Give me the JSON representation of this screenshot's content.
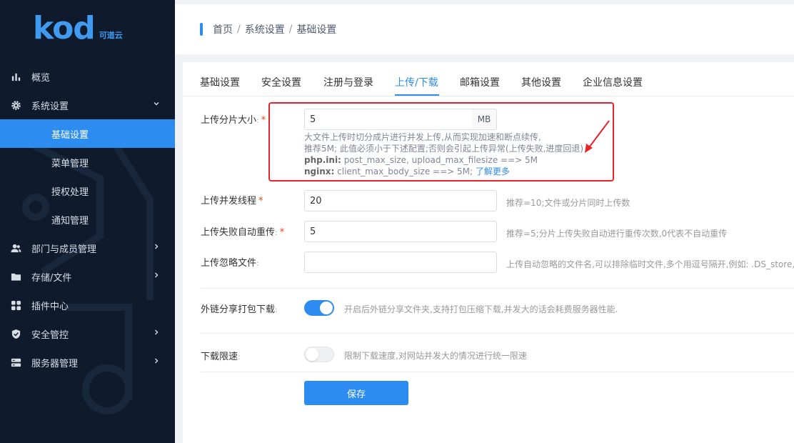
{
  "app": {
    "logo_mark": "kod",
    "logo_sub": "可道云",
    "brand_color": "#2d8cf0"
  },
  "sidebar": {
    "items": [
      {
        "label": "概览",
        "icon": "bar-chart-icon"
      },
      {
        "label": "系统设置",
        "icon": "gear-icon",
        "expanded": true
      },
      {
        "label": "基础设置",
        "icon": "sliders-icon",
        "active": true
      },
      {
        "label": "菜单管理",
        "icon": "menu-lines-icon"
      },
      {
        "label": "授权处理",
        "icon": "shield-icon"
      },
      {
        "label": "通知管理",
        "icon": "bell-icon"
      },
      {
        "label": "部门与成员管理",
        "icon": "users-icon"
      },
      {
        "label": "存储/文件",
        "icon": "folder-icon"
      },
      {
        "label": "插件中心",
        "icon": "grid-icon"
      },
      {
        "label": "安全管控",
        "icon": "shield-check-icon"
      },
      {
        "label": "服务器管理",
        "icon": "server-icon"
      }
    ]
  },
  "breadcrumb": {
    "items": [
      "首页",
      "系统设置",
      "基础设置"
    ],
    "sep": "/"
  },
  "tabs": [
    {
      "label": "基础设置"
    },
    {
      "label": "安全设置"
    },
    {
      "label": "注册与登录"
    },
    {
      "label": "上传/下载",
      "active": true
    },
    {
      "label": "邮箱设置"
    },
    {
      "label": "其他设置"
    },
    {
      "label": "企业信息设置"
    }
  ],
  "form": {
    "chunk_size": {
      "label": "上传分片大小",
      "value": "5",
      "unit": "MB",
      "desc_line1": "大文件上传时切分成片进行并发上传,从而实现加速和断点续传,",
      "desc_line2": "推荐5M; 此值必须小于下述配置;否则会引起上传异常(上传失败,进度回退)",
      "desc_php_label": "php.ini:",
      "desc_php_text": "post_max_size, upload_max_filesize ==> 5M",
      "desc_nginx_label": "nginx:",
      "desc_nginx_text": "client_max_body_size ==> 5M;",
      "learn_more": "了解更多"
    },
    "threads": {
      "label": "上传并发线程",
      "value": "20",
      "hint": "推荐=10;文件或分片同时上传数"
    },
    "retry": {
      "label": "上传失败自动重传",
      "value": "5",
      "hint": "推荐=5;分片上传失败自动进行重传次数,0代表不自动重传"
    },
    "ignore": {
      "label": "上传忽略文件",
      "value": "",
      "hint": "上传自动忽略的文件名,可以排除临时文件,多个用逗号隔开,例如: .DS_store,th"
    },
    "share_zip": {
      "label": "外链分享打包下载",
      "enabled": true,
      "hint": "开启后外链分享文件夹,支持打包压缩下载,并发大的话会耗费服务器性能."
    },
    "speed_limit": {
      "label": "下载限速",
      "enabled": false,
      "hint": "限制下载速度,对网站并发大的情况进行统一限速"
    },
    "required_mark": "*",
    "colon": ":",
    "save_label": "保存"
  },
  "annotation": {
    "box_color": "#e8242b"
  }
}
